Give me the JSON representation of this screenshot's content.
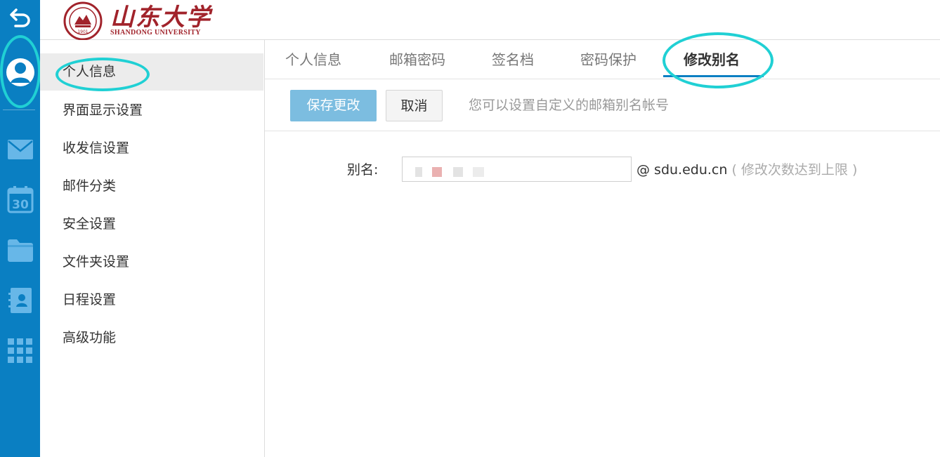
{
  "rail": {
    "icons": [
      "back-icon",
      "avatar-icon",
      "mail-icon",
      "calendar-icon",
      "folder-icon",
      "contacts-icon",
      "apps-grid-icon"
    ],
    "calendar_day": "30",
    "colors": {
      "background": "#0a7fc2",
      "highlight_ring": "#20d0d4"
    }
  },
  "header": {
    "logo_cn": "山东大学",
    "logo_en": "SHANDONG UNIVERSITY",
    "seal_year": "1901"
  },
  "sidebar": {
    "items": [
      {
        "label": "个人信息",
        "active": true
      },
      {
        "label": "界面显示设置",
        "active": false
      },
      {
        "label": "收发信设置",
        "active": false
      },
      {
        "label": "邮件分类",
        "active": false
      },
      {
        "label": "安全设置",
        "active": false
      },
      {
        "label": "文件夹设置",
        "active": false
      },
      {
        "label": "日程设置",
        "active": false
      },
      {
        "label": "高级功能",
        "active": false
      }
    ]
  },
  "tabs": [
    {
      "label": "个人信息",
      "active": false
    },
    {
      "label": "邮箱密码",
      "active": false
    },
    {
      "label": "签名档",
      "active": false
    },
    {
      "label": "密码保护",
      "active": false
    },
    {
      "label": "修改别名",
      "active": true
    }
  ],
  "toolbar": {
    "save_label": "保存更改",
    "cancel_label": "取消",
    "hint": "您可以设置自定义的邮箱别名帐号"
  },
  "form": {
    "alias_label": "别名:",
    "alias_value": "",
    "domain": "@ sdu.edu.cn",
    "limit_note": "( 修改次数达到上限 )"
  },
  "colors": {
    "primary": "#0a7fc2",
    "save_button": "#7cbde0",
    "logo_red": "#a1232b"
  }
}
